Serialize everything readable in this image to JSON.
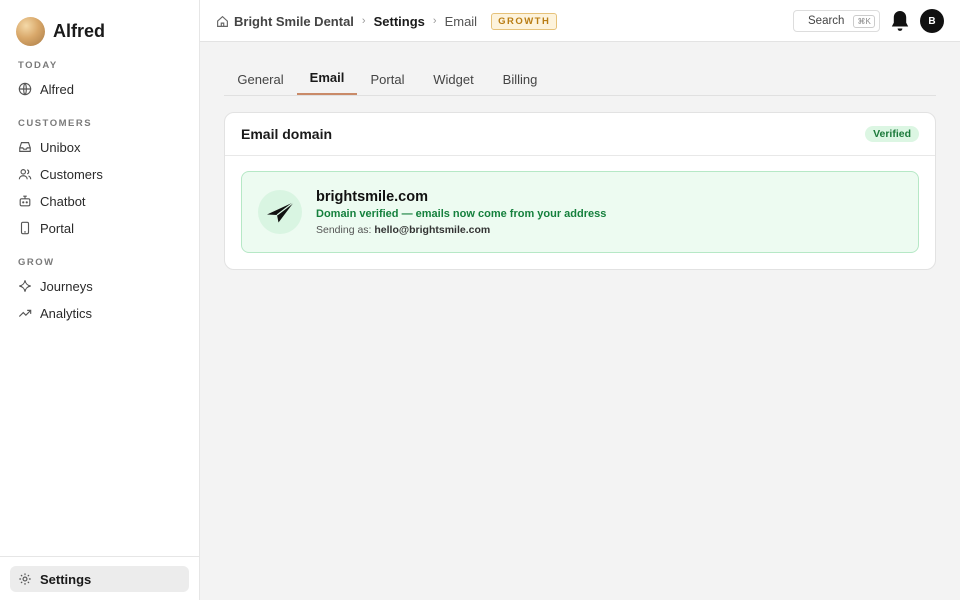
{
  "sidebar": {
    "brand": "Alfred",
    "sections": [
      {
        "label": "TODAY",
        "items": [
          {
            "label": "Alfred",
            "icon": "globe-icon"
          }
        ]
      },
      {
        "label": "CUSTOMERS",
        "items": [
          {
            "label": "Unibox",
            "icon": "inbox-icon"
          },
          {
            "label": "Customers",
            "icon": "users-icon"
          },
          {
            "label": "Chatbot",
            "icon": "bot-icon"
          },
          {
            "label": "Portal",
            "icon": "phone-icon"
          }
        ]
      },
      {
        "label": "GROW",
        "items": [
          {
            "label": "Journeys",
            "icon": "sparkle-icon"
          },
          {
            "label": "Analytics",
            "icon": "trend-icon"
          }
        ]
      }
    ],
    "footer": {
      "label": "Settings",
      "icon": "gear-icon"
    }
  },
  "topbar": {
    "breadcrumb": [
      "Bright Smile Dental",
      "Settings",
      "Email"
    ],
    "plan": "GROWTH",
    "search_label": "Search",
    "search_shortcut": "⌘K",
    "avatar_initial": "B"
  },
  "tabs": [
    "General",
    "Email",
    "Portal",
    "Widget",
    "Billing"
  ],
  "active_tab": "Email",
  "card": {
    "title": "Email domain",
    "status_badge": "Verified",
    "domain": "brightsmile.com",
    "status_text": "Domain verified — emails now come from your address",
    "sending_prefix": "Sending as:",
    "sending_address": "hello@brightsmile.com"
  },
  "colors": {
    "accent_tab": "#c98a68",
    "verified_green": "#15803d",
    "plan_amber": "#b97d14"
  }
}
